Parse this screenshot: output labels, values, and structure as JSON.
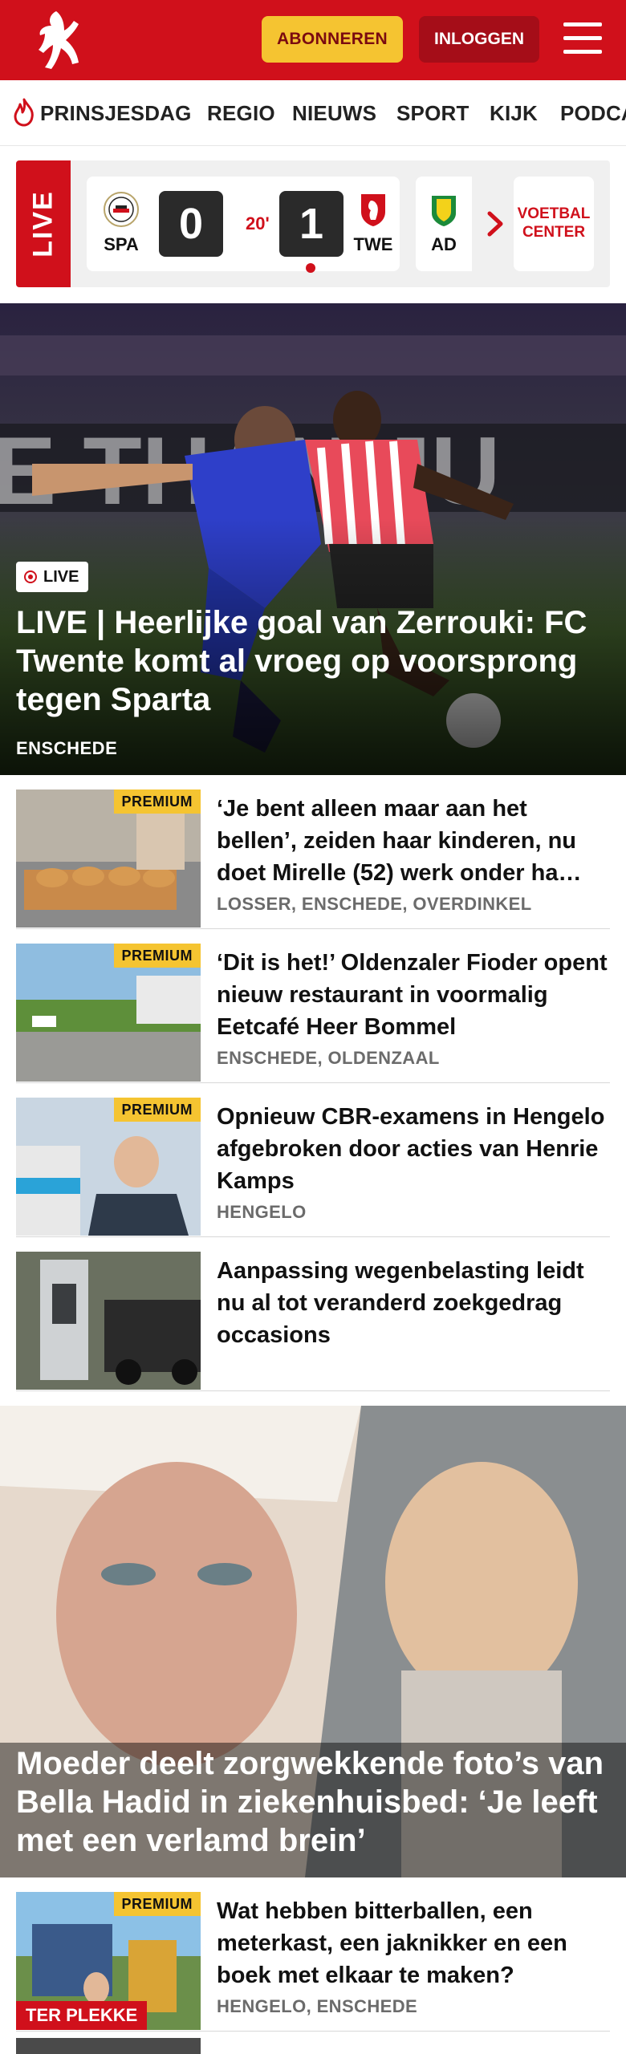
{
  "header": {
    "subscribe_label": "ABONNEREN",
    "login_label": "INLOGGEN",
    "colors": {
      "brand": "#d0101b",
      "accent": "#f5c431",
      "login_bg": "#a50d18"
    }
  },
  "nav": {
    "items": [
      "PRINSJESDAG",
      "REGIO",
      "NIEUWS",
      "SPORT",
      "KIJK",
      "PODCA"
    ]
  },
  "live": {
    "tab_label": "LIVE",
    "match": {
      "home": "SPA",
      "away": "TWE",
      "home_score": "0",
      "away_score": "1",
      "minute": "20'"
    },
    "next_team": "AD",
    "more_label": "VOETBAL\nCENTER"
  },
  "hero": {
    "badge": "LIVE",
    "title": "LIVE | Heerlijke goal van Zerrouki: FC Twente komt al vroeg op voorsprong tegen Sparta",
    "location": "ENSCHEDE"
  },
  "articles": [
    {
      "premium": "PREMIUM",
      "title": "‘Je bent alleen maar aan het bellen’, zeiden haar kinderen, nu doet Mirelle (52) werk onder ha…",
      "location": "LOSSER, ENSCHEDE, OVERDINKEL"
    },
    {
      "premium": "PREMIUM",
      "title": "‘Dit is het!’ Oldenzaler Fioder opent nieuw restaurant in voormalig Eetcafé Heer Bommel",
      "location": "ENSCHEDE, OLDENZAAL"
    },
    {
      "premium": "PREMIUM",
      "title": "Opnieuw CBR-examens in Hengelo afgebroken door acties van Henrie Kamps",
      "location": "HENGELO"
    },
    {
      "premium": "",
      "title": "Aanpassing wegenbelasting leidt nu al tot veranderd zoekgedrag occasions",
      "location": ""
    }
  ],
  "hero2": {
    "title": "Moeder deelt zorgwekkende foto’s van Bella Hadid in ziekenhuisbed: ‘Je leeft met een verlamd brein’"
  },
  "article_bottom": {
    "premium": "PREMIUM",
    "tag": "TER PLEKKE",
    "title": "Wat hebben bitterballen, een meterkast, een jaknikker en een boek met elkaar te maken?",
    "location": "HENGELO, ENSCHEDE"
  }
}
